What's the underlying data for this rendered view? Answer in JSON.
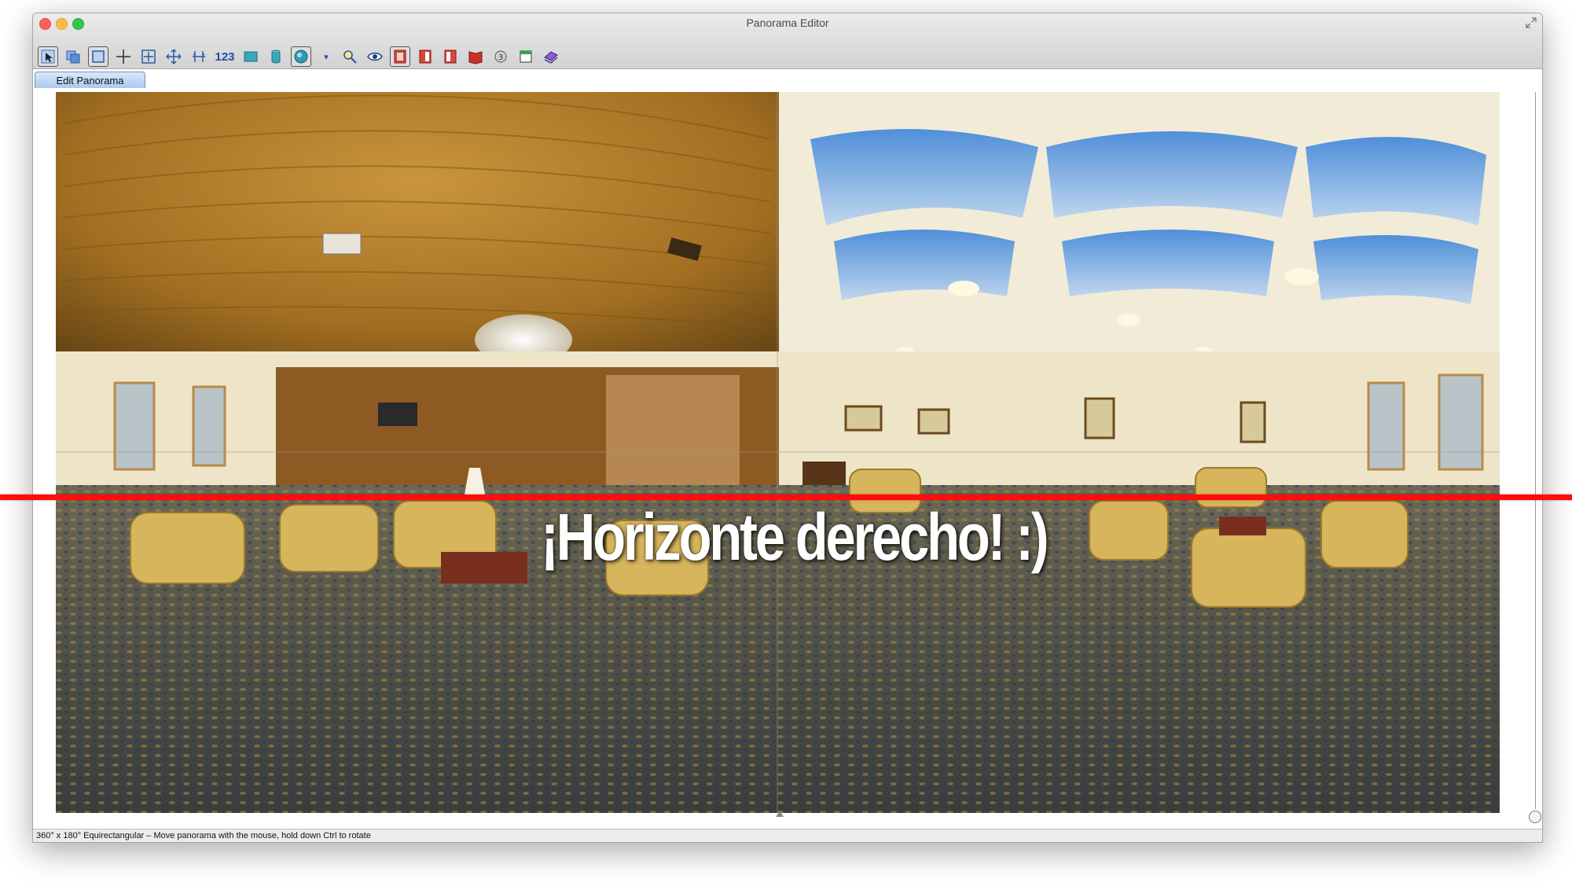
{
  "window": {
    "title": "Panorama Editor"
  },
  "toolbar": {
    "buttons": [
      {
        "name": "select-tool-icon"
      },
      {
        "name": "copy-layers-icon"
      },
      {
        "name": "crop-frame-icon"
      },
      {
        "name": "crosshair-plus-icon"
      },
      {
        "name": "fit-frame-icon"
      },
      {
        "name": "move-arrows-icon"
      },
      {
        "name": "straighten-icon"
      },
      {
        "name": "number-label",
        "text": "123"
      },
      {
        "name": "image-rect-icon"
      },
      {
        "name": "cylinder-icon"
      },
      {
        "name": "sphere-icon"
      },
      {
        "name": "dropdown-triangle-icon"
      },
      {
        "name": "magnifier-icon"
      },
      {
        "name": "eye-icon"
      },
      {
        "name": "red-frame-icon"
      },
      {
        "name": "red-page-icon"
      },
      {
        "name": "red-page-2-icon"
      },
      {
        "name": "red-book-icon"
      },
      {
        "name": "circle-3-icon"
      },
      {
        "name": "window-icon"
      },
      {
        "name": "purple-stack-icon"
      }
    ]
  },
  "tabs": [
    {
      "label": "Edit Panorama",
      "active": true
    }
  ],
  "overlay": {
    "text": "¡Horizonte derecho! :)",
    "line_color": "#ff0d0d"
  },
  "statusbar": {
    "text": "360° x 180° Equirectangular – Move panorama with the mouse, hold down Ctrl to rotate"
  },
  "colors": {
    "tab_active": "#a9c8ee",
    "accent": "#1e4fa8",
    "horizon_line": "#ff0d0d"
  }
}
